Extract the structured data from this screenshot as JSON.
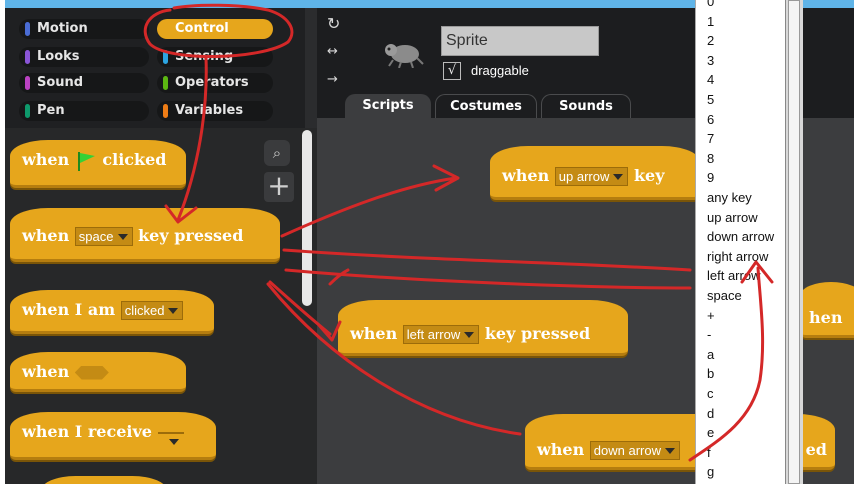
{
  "categories": [
    {
      "label": "Motion",
      "color": "#4a6cd4"
    },
    {
      "label": "Looks",
      "color": "#8a55d7"
    },
    {
      "label": "Sound",
      "color": "#bb42c3"
    },
    {
      "label": "Pen",
      "color": "#0e9a6c"
    },
    {
      "label": "Control",
      "color": "#e6a61c",
      "selected": true
    },
    {
      "label": "Sensing",
      "color": "#2ca5e2"
    },
    {
      "label": "Operators",
      "color": "#5cb712"
    },
    {
      "label": "Variables",
      "color": "#ee7d16"
    }
  ],
  "palette": {
    "when_flag": {
      "when": "when",
      "clicked": "clicked"
    },
    "when_key": {
      "when": "when",
      "key": "space",
      "rest": "key pressed"
    },
    "when_i_am": {
      "text": "when I am",
      "option": "clicked"
    },
    "when_cond": {
      "text": "when"
    },
    "when_receive": {
      "text": "when I receive",
      "option": ""
    }
  },
  "sprite": {
    "name": "Sprite",
    "draggable_label": "draggable",
    "draggable_checked": "√"
  },
  "tabs": [
    "Scripts",
    "Costumes",
    "Sounds"
  ],
  "scripts": {
    "up": {
      "when": "when",
      "key": "up arrow",
      "rest": "key"
    },
    "left": {
      "when": "when",
      "key": "left arrow",
      "rest": "key pressed"
    },
    "down": {
      "when": "when",
      "key": "down arrow",
      "rest": "ed"
    },
    "right_partial": {
      "text": "hen"
    }
  },
  "key_menu": {
    "items": [
      "0",
      "1",
      "2",
      "3",
      "4",
      "5",
      "6",
      "7",
      "8",
      "9",
      "any key",
      "up arrow",
      "down arrow",
      "right arrow",
      "left arrow",
      "space",
      "+",
      "-",
      "a",
      "b",
      "c",
      "d",
      "e",
      "f",
      "g"
    ]
  },
  "colors": {
    "control": "#e6a61c",
    "annotation": "#d42828",
    "topbar": "#5fb4e8"
  }
}
